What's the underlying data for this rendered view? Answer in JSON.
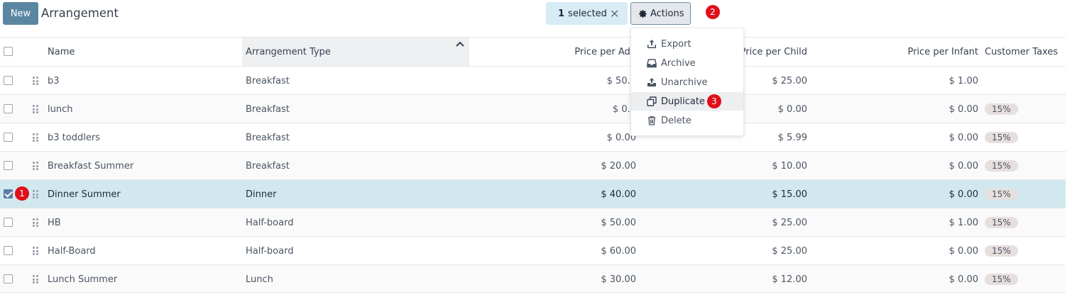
{
  "toolbar": {
    "new_label": "New",
    "title": "Arrangement",
    "selected_count": "1",
    "selected_text": "selected",
    "actions_label": "Actions"
  },
  "markers": {
    "one": "1",
    "two": "2",
    "three": "3"
  },
  "columns": {
    "name": "Name",
    "type": "Arrangement Type",
    "adult": "Price per Adu",
    "child": "Price per Child",
    "infant": "Price per Infant",
    "taxes": "Customer Taxes"
  },
  "rows": [
    {
      "name": "b3",
      "type": "Breakfast",
      "adult": "$ 50.0",
      "child": "$ 25.00",
      "infant": "$ 1.00",
      "tax": ""
    },
    {
      "name": "lunch",
      "type": "Breakfast",
      "adult": "$ 0.0",
      "child": "$ 0.00",
      "infant": "$ 0.00",
      "tax": "15%"
    },
    {
      "name": "b3 toddlers",
      "type": "Breakfast",
      "adult": "$ 0.00",
      "child": "$ 5.99",
      "infant": "$ 0.00",
      "tax": "15%"
    },
    {
      "name": "Breakfast Summer",
      "type": "Breakfast",
      "adult": "$ 20.00",
      "child": "$ 10.00",
      "infant": "$ 0.00",
      "tax": "15%"
    },
    {
      "name": "Dinner Summer",
      "type": "Dinner",
      "adult": "$ 40.00",
      "child": "$ 15.00",
      "infant": "$ 0.00",
      "tax": "15%"
    },
    {
      "name": "HB",
      "type": "Half-board",
      "adult": "$ 50.00",
      "child": "$ 25.00",
      "infant": "$ 1.00",
      "tax": "15%"
    },
    {
      "name": "Half-Board",
      "type": "Half-board",
      "adult": "$ 60.00",
      "child": "$ 25.00",
      "infant": "$ 0.00",
      "tax": "15%"
    },
    {
      "name": "Lunch Summer",
      "type": "Lunch",
      "adult": "$ 30.00",
      "child": "$ 12.00",
      "infant": "$ 0.00",
      "tax": "15%"
    }
  ],
  "menu": {
    "export": "Export",
    "archive": "Archive",
    "unarchive": "Unarchive",
    "duplicate": "Duplicate",
    "delete": "Delete"
  },
  "colors": {
    "primary": "#5b86a2",
    "selected_row": "#d1e9ee",
    "marker": "#e0101a",
    "tag_bg": "#e7dede"
  }
}
